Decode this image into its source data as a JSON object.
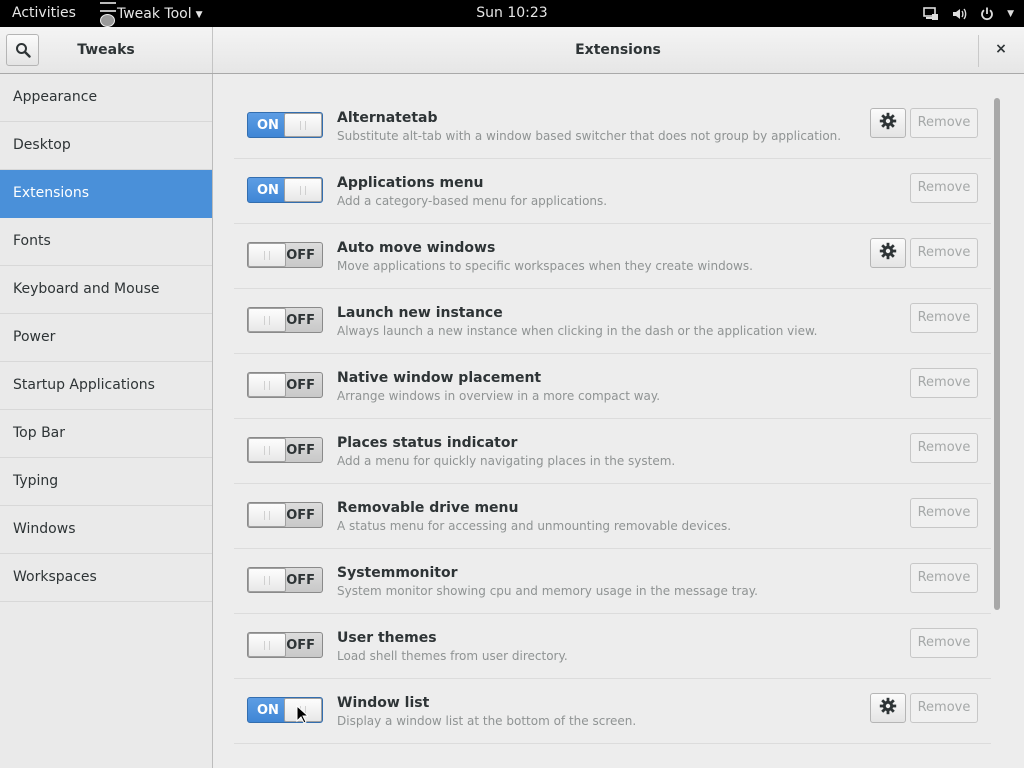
{
  "topbar": {
    "activities": "Activities",
    "app_menu": "Tweak Tool",
    "clock": "Sun 10:23",
    "tray_icons": [
      "network-wired-icon",
      "volume-icon",
      "power-icon"
    ]
  },
  "header": {
    "left_title": "Tweaks",
    "main_title": "Extensions",
    "close": "×"
  },
  "sidebar": {
    "items": [
      {
        "label": "Appearance"
      },
      {
        "label": "Desktop"
      },
      {
        "label": "Extensions",
        "active": true
      },
      {
        "label": "Fonts"
      },
      {
        "label": "Keyboard and Mouse"
      },
      {
        "label": "Power"
      },
      {
        "label": "Startup Applications"
      },
      {
        "label": "Top Bar"
      },
      {
        "label": "Typing"
      },
      {
        "label": "Windows"
      },
      {
        "label": "Workspaces"
      }
    ]
  },
  "colors": {
    "accent": "#4a90d9",
    "topbar": "#000000",
    "switch_on": "#4a90d9"
  },
  "extensions": [
    {
      "name": "Alternatetab",
      "description": "Substitute alt-tab with a window based switcher that does not group by application.",
      "state": "ON",
      "has_settings": true,
      "remove_label": "Remove"
    },
    {
      "name": "Applications menu",
      "description": "Add a category-based menu for applications.",
      "state": "ON",
      "has_settings": false,
      "remove_label": "Remove"
    },
    {
      "name": "Auto move windows",
      "description": "Move applications to specific workspaces when they create windows.",
      "state": "OFF",
      "has_settings": true,
      "remove_label": "Remove"
    },
    {
      "name": "Launch new instance",
      "description": "Always launch a new instance when clicking in the dash or the application view.",
      "state": "OFF",
      "has_settings": false,
      "remove_label": "Remove"
    },
    {
      "name": "Native window placement",
      "description": "Arrange windows in overview in a more compact way.",
      "state": "OFF",
      "has_settings": false,
      "remove_label": "Remove"
    },
    {
      "name": "Places status indicator",
      "description": "Add a menu for quickly navigating places in the system.",
      "state": "OFF",
      "has_settings": false,
      "remove_label": "Remove"
    },
    {
      "name": "Removable drive menu",
      "description": "A status menu for accessing and unmounting removable devices.",
      "state": "OFF",
      "has_settings": false,
      "remove_label": "Remove"
    },
    {
      "name": "Systemmonitor",
      "description": "System monitor showing cpu and memory usage in the message tray.",
      "state": "OFF",
      "has_settings": false,
      "remove_label": "Remove"
    },
    {
      "name": "User themes",
      "description": "Load shell themes from user directory.",
      "state": "OFF",
      "has_settings": false,
      "remove_label": "Remove"
    },
    {
      "name": "Window list",
      "description": "Display a window list at the bottom of the screen.",
      "state": "ON",
      "has_settings": true,
      "remove_label": "Remove"
    }
  ]
}
